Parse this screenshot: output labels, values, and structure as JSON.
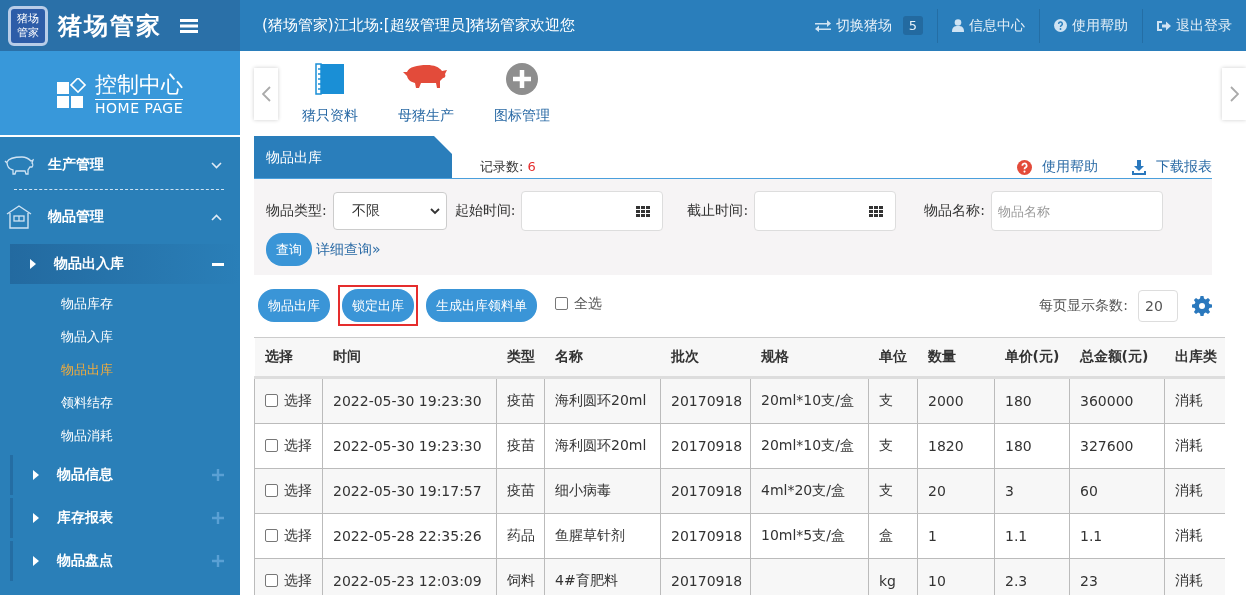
{
  "header": {
    "logo_badge": "猪场管家",
    "app_name": "猪场管家",
    "welcome": "(猪场管家)江北场:[超级管理员]猪场管家欢迎您",
    "actions": [
      {
        "kind": "switch",
        "label": "切换猪场",
        "badge": "5"
      },
      {
        "kind": "user",
        "label": "信息中心"
      },
      {
        "kind": "help",
        "label": "使用帮助"
      },
      {
        "kind": "logout",
        "label": "退出登录"
      }
    ]
  },
  "sidebar": {
    "title": "控制中心",
    "subtitle": "HOME PAGE",
    "groups": [
      {
        "label": "生产管理",
        "expanded": false
      },
      {
        "label": "物品管理",
        "expanded": true,
        "children": [
          {
            "label": "物品出入库",
            "expanded": true,
            "children": [
              {
                "label": "物品库存",
                "selected": false
              },
              {
                "label": "物品入库",
                "selected": false
              },
              {
                "label": "物品出库",
                "selected": true
              },
              {
                "label": "领料结存",
                "selected": false
              },
              {
                "label": "物品消耗",
                "selected": false
              }
            ]
          },
          {
            "label": "物品信息",
            "expanded": false
          },
          {
            "label": "库存报表",
            "expanded": false
          },
          {
            "label": "物品盘点",
            "expanded": false
          }
        ]
      }
    ]
  },
  "shortcuts": [
    {
      "label": "猪只资料"
    },
    {
      "label": "母猪生产"
    },
    {
      "label": "图标管理"
    }
  ],
  "panel": {
    "title": "物品出库",
    "record_label": "记录数:",
    "record_count": "6",
    "help": "使用帮助",
    "download": "下载报表"
  },
  "filters": {
    "type_label": "物品类型:",
    "type_value": "不限",
    "start_label": "起始时间:",
    "end_label": "截止时间:",
    "name_label": "物品名称:",
    "name_placeholder": "物品名称",
    "query": "查询",
    "advanced": "详细查询»"
  },
  "actions": [
    {
      "label": "物品出库",
      "highlighted": false
    },
    {
      "label": "锁定出库",
      "highlighted": true
    },
    {
      "label": "生成出库领料单",
      "highlighted": false
    }
  ],
  "select_all": {
    "label": "全选",
    "checked": false
  },
  "page_size": {
    "label": "每页显示条数:",
    "value": "20"
  },
  "table": {
    "columns": [
      "选择",
      "时间",
      "类型",
      "名称",
      "批次",
      "规格",
      "单位",
      "数量",
      "单价(元)",
      "总金额(元)",
      "出库类"
    ],
    "rows": [
      {
        "checked": false,
        "cells": [
          "选择",
          "2022-05-30 19:23:30",
          "疫苗",
          "海利圆环20ml",
          "20170918",
          "20ml*10支/盒",
          "支",
          "2000",
          "180",
          "360000",
          "消耗"
        ]
      },
      {
        "checked": false,
        "cells": [
          "选择",
          "2022-05-30 19:23:30",
          "疫苗",
          "海利圆环20ml",
          "20170918",
          "20ml*10支/盒",
          "支",
          "1820",
          "180",
          "327600",
          "消耗"
        ]
      },
      {
        "checked": false,
        "cells": [
          "选择",
          "2022-05-30 19:17:57",
          "疫苗",
          "细小病毒",
          "20170918",
          "4ml*20支/盒",
          "支",
          "20",
          "3",
          "60",
          "消耗"
        ]
      },
      {
        "checked": false,
        "cells": [
          "选择",
          "2022-05-28 22:35:26",
          "药品",
          "鱼腥草针剂",
          "20170918",
          "10ml*5支/盒",
          "盒",
          "1",
          "1.1",
          "1.1",
          "消耗"
        ]
      },
      {
        "checked": false,
        "cells": [
          "选择",
          "2022-05-23 12:03:09",
          "饲料",
          "4#育肥料",
          "20170918",
          "",
          "kg",
          "10",
          "2.3",
          "23",
          "消耗"
        ]
      }
    ]
  }
}
